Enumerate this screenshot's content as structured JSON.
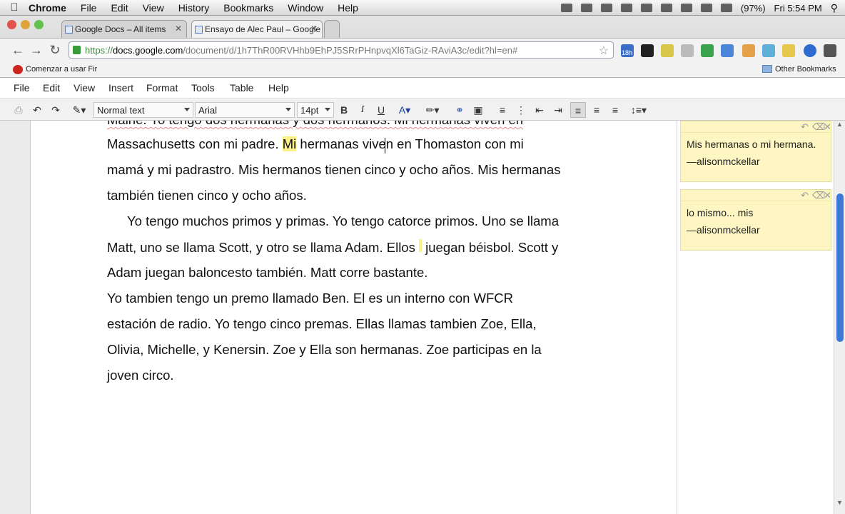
{
  "menubar": {
    "apple": "",
    "items": [
      "Chrome",
      "File",
      "Edit",
      "View",
      "History",
      "Bookmarks",
      "Window",
      "Help"
    ],
    "battery": "(97%)",
    "clock": "Fri 5:54 PM"
  },
  "browser": {
    "tabs": [
      {
        "label": "Google Docs – All items"
      },
      {
        "label": "Ensayo de Alec Paul – Google"
      }
    ],
    "url_https": "https://",
    "url_host": "docs.google.com",
    "url_path": "/document/d/1h7ThR00RVHhb9EhPJ5SRrPHnpvqXl6TaGiz-RAviA3c/edit?hl=en#",
    "ext_badge": "18h",
    "bookmark_left": "Comenzar a usar Fir",
    "bookmark_right": "Other Bookmarks"
  },
  "docs": {
    "menu": [
      "File",
      "Edit",
      "View",
      "Insert",
      "Format",
      "Tools",
      "Table",
      "Help"
    ],
    "style_select": "Normal text",
    "font_select": "Arial",
    "size_select": "14pt"
  },
  "document": {
    "line0": "Maine. Yo tengo dos hermanas y dos hermanos. Mi hermanas viven en",
    "line1a": "Massachusetts con mi padre. ",
    "line1b": "Mi",
    "line1c": " hermanas ",
    "line1d": "viven en Thomaston con mi",
    "line2a": "mamá y mi padrastro. Mis hermanos tienen cinco y ocho años",
    "line2b": ". Mis hermanas",
    "line3": "también tienen cinco y ocho años.",
    "line4": "Yo tengo muchos primos y primas. Yo tengo catorce primos. Uno se llama",
    "line5a": "Matt, uno se llama Scott, y otro se llama Adam. Ellos ",
    "line5b": " juegan béisbol. Scott y",
    "line6": "Adam juegan baloncesto también. Matt corre bastante.",
    "line7": "Yo tambien tengo un premo llamado Ben. El es un interno con WFCR",
    "line8": "estación de radio. Yo tengo cinco premas. Ellas llamas tambien Zoe, Ella,",
    "line9": "Olivia, Michelle, y Kenersin. Zoe y Ella son hermanas. Zoe participas en la",
    "line10": "joven circo."
  },
  "comments": [
    {
      "text": "Mis hermanas o mi hermana.",
      "author": "—alisonmckellar"
    },
    {
      "text": "lo mismo... mis",
      "author": "—alisonmckellar"
    }
  ],
  "colors": {
    "highlight": "#fcf08a",
    "comment_bg": "#fdf6c2",
    "scroll_thumb": "#3f79d6"
  }
}
